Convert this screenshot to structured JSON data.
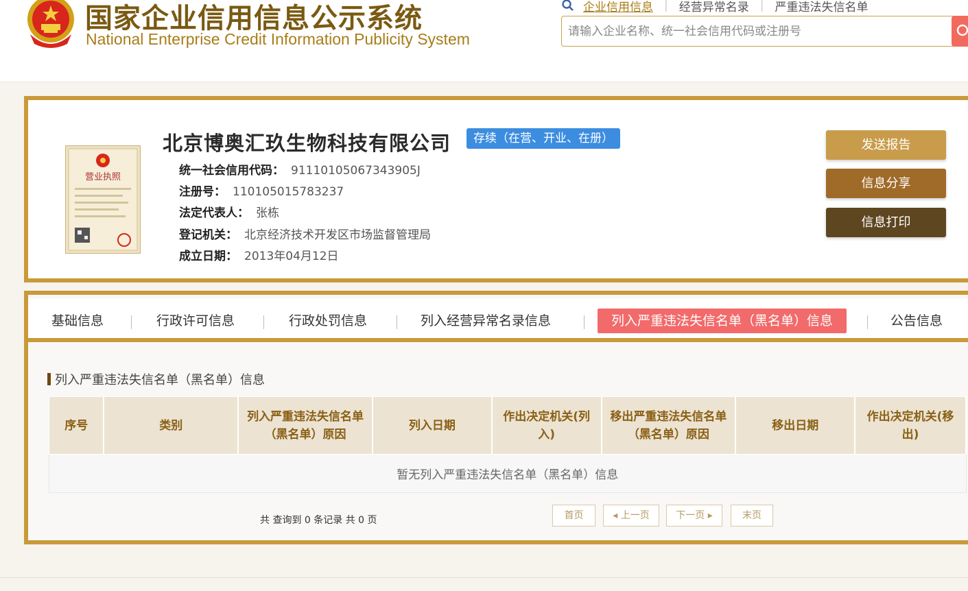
{
  "header": {
    "title_cn": "国家企业信用信息公示系统",
    "title_en": "National Enterprise Credit Information Publicity System",
    "quick_links": [
      "企业信用信息",
      "经营异常名录",
      "严重违法失信名单"
    ],
    "search_placeholder": "请输入企业名称、统一社会信用代码或注册号"
  },
  "company": {
    "name": "北京博奥汇玖生物科技有限公司",
    "status": "存续（在营、开业、在册）",
    "fields": [
      {
        "label": "统一社会信用代码：",
        "value": "91110105067343905J"
      },
      {
        "label": "注册号：",
        "value": "110105015783237"
      },
      {
        "label": "法定代表人：",
        "value": "张栋"
      },
      {
        "label": "登记机关：",
        "value": "北京经济技术开发区市场监督管理局"
      },
      {
        "label": "成立日期：",
        "value": "2013年04月12日"
      }
    ],
    "license_title": "营业执照",
    "actions": {
      "send": "发送报告",
      "share": "信息分享",
      "print": "信息打印"
    }
  },
  "tabs": [
    "基础信息",
    "行政许可信息",
    "行政处罚信息",
    "列入经营异常名录信息",
    "列入严重违法失信名单（黑名单）信息",
    "公告信息"
  ],
  "active_tab_index": 4,
  "section": {
    "title": "列入严重违法失信名单（黑名单）信息",
    "columns": [
      "序号",
      "类别",
      "列入严重违法失信名单（黑名单）原因",
      "列入日期",
      "作出决定机关(列入)",
      "移出严重违法失信名单（黑名单）原因",
      "移出日期",
      "作出决定机关(移出)"
    ],
    "empty_text": "暂无列入严重违法失信名单（黑名单）信息"
  },
  "pagination": {
    "summary": "共 查询到 0 条记录 共 0 页",
    "first": "首页",
    "prev": "上一页",
    "next": "下一页",
    "last": "末页"
  },
  "colors": {
    "brand_gold": "#c99a3a",
    "title_brown": "#7a5a12",
    "status_blue": "#3c8de0",
    "active_tab": "#f26a6a",
    "btn_send": "#c89c4a",
    "btn_share": "#a06a28",
    "btn_print": "#5e4620"
  }
}
